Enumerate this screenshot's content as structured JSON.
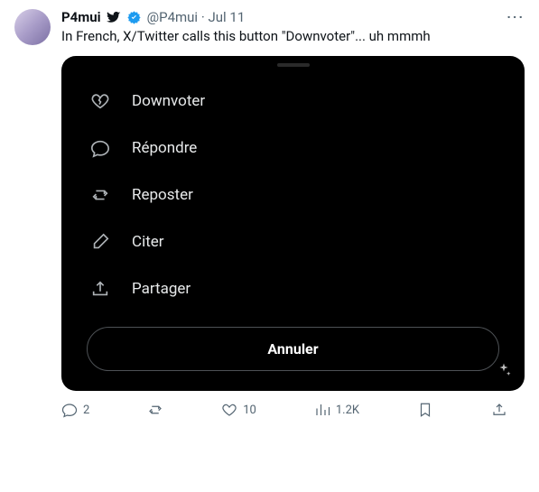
{
  "tweet": {
    "author": {
      "display_name": "P4mui",
      "handle": "@P4mui",
      "date": "Jul 11",
      "separator": "·"
    },
    "text": "In French, X/Twitter calls this button \"Downvoter\"... uh mmmh",
    "menu": {
      "items": [
        {
          "icon": "broken-heart-icon",
          "label": "Downvoter"
        },
        {
          "icon": "reply-icon",
          "label": "Répondre"
        },
        {
          "icon": "repost-icon",
          "label": "Reposter"
        },
        {
          "icon": "quote-icon",
          "label": "Citer"
        },
        {
          "icon": "share-icon",
          "label": "Partager"
        }
      ],
      "cancel_label": "Annuler"
    },
    "actions": {
      "reply_count": "2",
      "like_count": "10",
      "view_count": "1.2K"
    }
  }
}
